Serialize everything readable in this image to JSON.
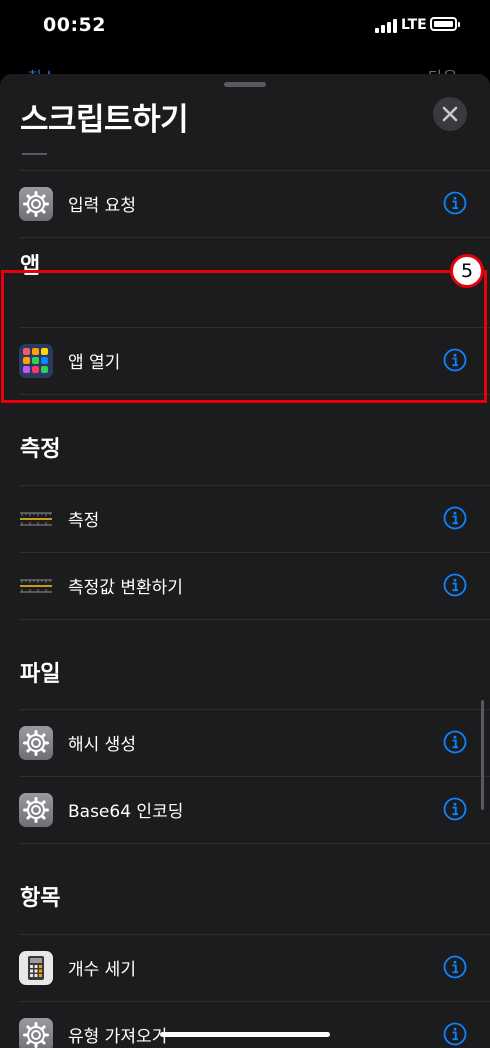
{
  "status_bar": {
    "time": "00:52",
    "network": "LTE"
  },
  "behind_sheet": {
    "left_action": "취소",
    "right_action": "다음"
  },
  "sheet": {
    "title": "스크립트하기"
  },
  "rows_top": [
    {
      "label": "입력 요청",
      "icon": "gear-icon"
    }
  ],
  "sections": [
    {
      "header": "앱",
      "items": [
        {
          "label": "앱 열기",
          "icon": "app-grid-icon"
        }
      ]
    },
    {
      "header": "측정",
      "items": [
        {
          "label": "측정",
          "icon": "ruler-icon"
        },
        {
          "label": "측정값 변환하기",
          "icon": "ruler-icon"
        }
      ]
    },
    {
      "header": "파일",
      "items": [
        {
          "label": "해시 생성",
          "icon": "gear-icon"
        },
        {
          "label": "Base64 인코딩",
          "icon": "gear-icon"
        }
      ]
    },
    {
      "header": "항목",
      "items": [
        {
          "label": "개수 세기",
          "icon": "calculator-icon"
        },
        {
          "label": "유형 가져오기",
          "icon": "gear-icon"
        }
      ]
    }
  ],
  "annotation": {
    "step_number": "5",
    "color": "#e8000b"
  },
  "colors": {
    "accent": "#0a84ff",
    "sheet_background": "#1c1c1e",
    "separator": "#2e2e31"
  }
}
